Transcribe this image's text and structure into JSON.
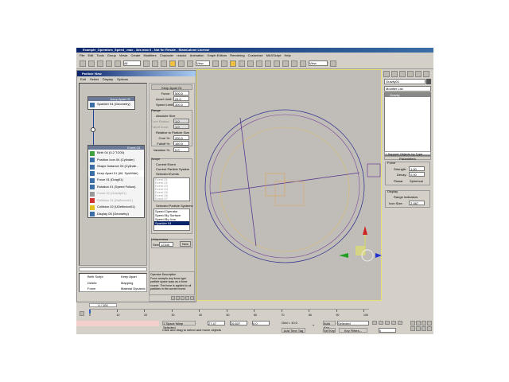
{
  "window": {
    "title": "Example_Operators_Speed_.max - 3ds max 6 - Not for Resale - Stand-alone License"
  },
  "menu": [
    "File",
    "Edit",
    "Tools",
    "Group",
    "Views",
    "Create",
    "Modifiers",
    "Character",
    "reactor",
    "Animation",
    "Graph Editors",
    "Rendering",
    "Customize",
    "MAXScript",
    "Help"
  ],
  "toolbar": {
    "selection_filter": "All",
    "ref_coord": "View",
    "ref_coord2": "View"
  },
  "particle_view": {
    "title": "Particle View",
    "menu": [
      "Edit",
      "Select",
      "Display",
      "Options"
    ],
    "global_event": {
      "title": "Keep Apart 01",
      "items": [
        "Sparkler 04 (Geometry)"
      ]
    },
    "event": {
      "title": "Event 03",
      "items": [
        "Birth 04 (0-2 T:200)",
        "Position Icon 04 (Cylinder)",
        "Shape Instance 03 (Cylinde...",
        "Keep Apart 01 (All, SysWide)",
        "Force 01 (Drag01)",
        "Rotation 01 (Speed Follow)",
        "Force 02 (Gravity01)",
        "Collision 01 (Deflector01)",
        "Collision 02 (UDeflector01)",
        "Display 05 (Geometry)"
      ]
    },
    "depot": [
      "Birth Script",
      "Delete",
      "Force",
      "Keep Apart",
      "Mapping",
      "Material Dynamic"
    ],
    "params": {
      "title": "Keep Apart 01",
      "force_label": "Force:",
      "force": "500.0",
      "accel_label": "Accel Limit:",
      "accel": "24.0",
      "speed_label": "Speed Limit:",
      "speed": "300.0",
      "range_label": "Range",
      "absolute": "Absolute Size",
      "core_radius_label": "Core Radius:",
      "core_radius": "1.0",
      "falloff_zone_label": "Falloff Zone:",
      "falloff_zone": "1.0",
      "relative": "Relative to Particle Size",
      "core_pct_label": "Core %:",
      "core_pct": "200.0",
      "falloff_pct_label": "Falloff %:",
      "falloff_pct": "160.0",
      "variation_label": "Variation %:",
      "variation": "0.0",
      "scope_label": "Scope",
      "scope_current_event": "Current Event",
      "scope_current_system": "Current Particle System",
      "scope_selected_events": "Selected Events",
      "events_list": [
        "Event 01",
        "Event 02",
        "Event 03",
        "Event 04",
        "Event 05",
        "Event 06",
        "Event 07"
      ],
      "scope_selected_systems": "Selected Particle Systems",
      "systems_list": [
        "Speed Operator",
        "Speed By Surface",
        "Speed By Icon",
        "Sparkler 04"
      ],
      "uniqueness_label": "Uniqueness",
      "seed_label": "Seed:",
      "seed": "12345",
      "new_label": "New",
      "desc_label": "Operator Description",
      "desc": "Force accepts any force-type particle space warp as a force source. The force is applied to all particles in the current event."
    }
  },
  "command_panel": {
    "object_name": "Gravity01",
    "modifier_list": "Modifier List",
    "stack_item": "Gravity",
    "rollup1": "+ Support Objects by Type",
    "rollup2": "Parameters",
    "force_label": "Force",
    "strength_label": "Strength:",
    "strength": "1.00",
    "decay_label": "Decay:",
    "decay": "0.00",
    "planar": "Planar",
    "spherical": "Spherical",
    "display_label": "Display",
    "range_indicators": "Range Indicators",
    "icon_size_label": "Icon Size:",
    "icon_size": "2.087"
  },
  "timeline": {
    "frame": "0 / 100",
    "ticks": [
      "0",
      "10",
      "20",
      "30",
      "40",
      "50",
      "60",
      "70",
      "80",
      "90",
      "100"
    ],
    "progress": 0
  },
  "status": {
    "selection": "1 Space Warp Selected",
    "x": "27.47",
    "y": "26.607",
    "z": "0.0",
    "grid": "Grid = 10.0",
    "prompt": "Click and drag to select and move objects",
    "add_time_tag": "Add Time Tag",
    "auto_key": "Auto Key",
    "selected": "Selected",
    "set_key": "Set Key",
    "key_filters": "Key Filters...",
    "frame": "0"
  }
}
